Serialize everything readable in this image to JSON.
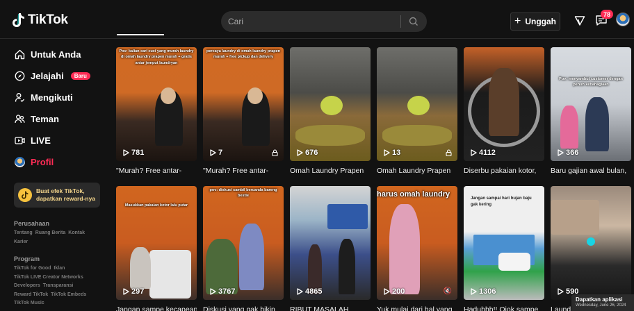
{
  "app": {
    "name": "TikTok"
  },
  "header": {
    "search_placeholder": "Cari",
    "upload_label": "Unggah",
    "inbox_count": "78"
  },
  "sidebar": {
    "items": [
      {
        "label": "Untuk Anda"
      },
      {
        "label": "Jelajahi",
        "badge": "Baru"
      },
      {
        "label": "Mengikuti"
      },
      {
        "label": "Teman"
      },
      {
        "label": "LIVE"
      },
      {
        "label": "Profil"
      }
    ],
    "promo": {
      "line1": "Buat efek TikTok,",
      "line2": "dapatkan reward-nya"
    },
    "footer": {
      "company_title": "Perusahaan",
      "company_links": [
        "Tentang",
        "Ruang Berita",
        "Kontak",
        "Karier"
      ],
      "program_title": "Program",
      "program_links": [
        "TikTok for Good",
        "Iklan",
        "TikTok LIVE Creator Networks",
        "Developers",
        "Transparansi",
        "Reward TikTok",
        "TikTok Embeds",
        "TikTok Music"
      ]
    }
  },
  "videos": [
    {
      "views": "781",
      "title": "\"Murah? Free antar-",
      "overlay": "Pov: kalian cari cuci yang murah laundry di omah laundry prapen murah + gratis antar jemput laundryan"
    },
    {
      "views": "7",
      "title": "\"Murah? Free antar-",
      "overlay": "percaya laundry di omah laundry prapen murah + free pickup dan delivery"
    },
    {
      "views": "676",
      "title": "Omah Laundry Prapen",
      "overlay": ""
    },
    {
      "views": "13",
      "title": "Omah Laundry Prapen",
      "overlay": ""
    },
    {
      "views": "4112",
      "title": "Diserbu pakaian kotor,",
      "overlay": ""
    },
    {
      "views": "366",
      "title": "Baru gajian awal bulan,",
      "overlay": "Pov: menyambut customer dengan penuh kebahagiaan"
    },
    {
      "views": "297",
      "title": "Jangan sampe kecapean",
      "overlay": "Masukkan pakaian kotor lalu putar"
    },
    {
      "views": "3767",
      "title": "Diskusi yang gak bikin",
      "overlay": "pov: diskusi sambil bercanda bareng bestie"
    },
    {
      "views": "4865",
      "title": "RIBUT MASALAH",
      "overlay": ""
    },
    {
      "views": "200",
      "title": "Yuk mulai dari hal yang",
      "overlay": "harus omah laundry"
    },
    {
      "views": "1306",
      "title": "Haduhhh!! Ojok sampe",
      "overlay": "Jangan sampai hari hujan baju gak kering"
    },
    {
      "views": "590",
      "title": "Laundry",
      "overlay": ""
    }
  ],
  "toast": {
    "title": "Dapatkan aplikasi",
    "date": "Wednesday, June 26, 2024"
  }
}
